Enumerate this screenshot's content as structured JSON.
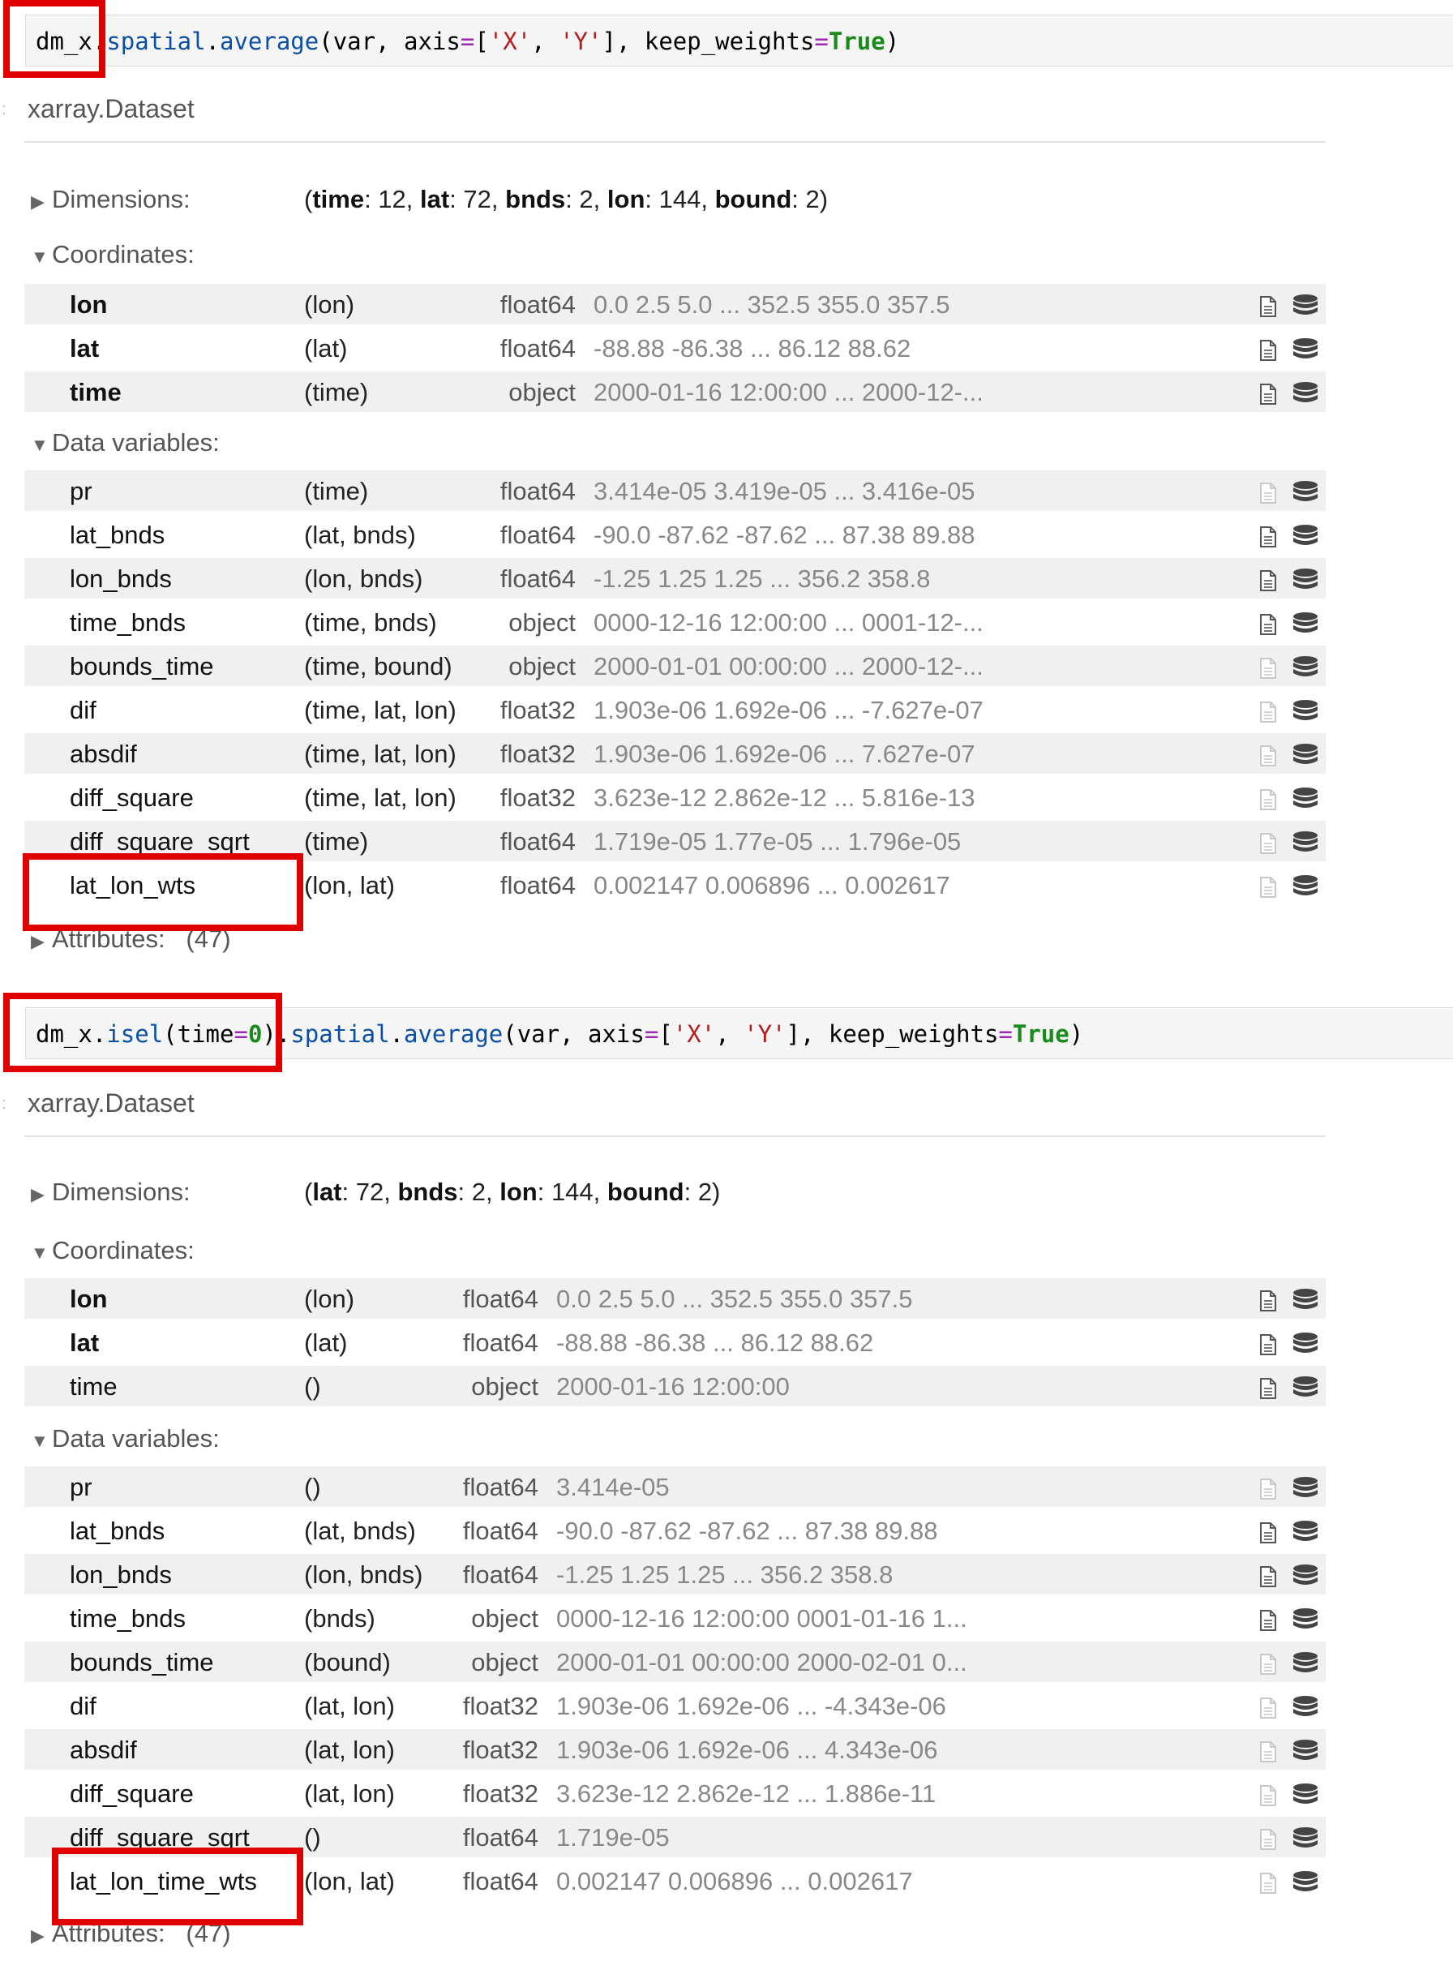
{
  "cells": [
    {
      "code": {
        "obj": "dm_x",
        "accessor": "spatial",
        "method": "average",
        "arg_var": "var",
        "kw_axis": "axis",
        "axis_vals": [
          "'X'",
          "'Y'"
        ],
        "kw_weights": "keep_weights",
        "bool_val": "True"
      },
      "output": {
        "gutter": ":",
        "title": "xarray.Dataset",
        "dimensions": {
          "label": "Dimensions:",
          "items": [
            {
              "name": "time",
              "size": "12"
            },
            {
              "name": "lat",
              "size": "72"
            },
            {
              "name": "bnds",
              "size": "2"
            },
            {
              "name": "lon",
              "size": "144"
            },
            {
              "name": "bound",
              "size": "2"
            }
          ]
        },
        "coordinates": {
          "label": "Coordinates:",
          "rows": [
            {
              "name": "lon",
              "dims": "(lon)",
              "dtype": "float64",
              "preview": "0.0 2.5 5.0 ... 352.5 355.0 357.5"
            },
            {
              "name": "lat",
              "dims": "(lat)",
              "dtype": "float64",
              "preview": "-88.88 -86.38 ... 86.12 88.62"
            },
            {
              "name": "time",
              "dims": "(time)",
              "dtype": "object",
              "preview": "2000-01-16 12:00:00 ... 2000-12-..."
            }
          ]
        },
        "data_variables": {
          "label": "Data variables:",
          "rows": [
            {
              "name": "pr",
              "dims": "(time)",
              "dtype": "float64",
              "preview": "3.414e-05 3.419e-05 ... 3.416e-05"
            },
            {
              "name": "lat_bnds",
              "dims": "(lat, bnds)",
              "dtype": "float64",
              "preview": "-90.0 -87.62 -87.62 ... 87.38 89.88"
            },
            {
              "name": "lon_bnds",
              "dims": "(lon, bnds)",
              "dtype": "float64",
              "preview": "-1.25 1.25 1.25 ... 356.2 358.8"
            },
            {
              "name": "time_bnds",
              "dims": "(time, bnds)",
              "dtype": "object",
              "preview": "0000-12-16 12:00:00 ... 0001-12-..."
            },
            {
              "name": "bounds_time",
              "dims": "(time, bound)",
              "dtype": "object",
              "preview": "2000-01-01 00:00:00 ... 2000-12-..."
            },
            {
              "name": "dif",
              "dims": "(time, lat, lon)",
              "dtype": "float32",
              "preview": "1.903e-06 1.692e-06 ... -7.627e-07"
            },
            {
              "name": "absdif",
              "dims": "(time, lat, lon)",
              "dtype": "float32",
              "preview": "1.903e-06 1.692e-06 ... 7.627e-07"
            },
            {
              "name": "diff_square",
              "dims": "(time, lat, lon)",
              "dtype": "float32",
              "preview": "3.623e-12 2.862e-12 ... 5.816e-13"
            },
            {
              "name": "diff_square_sqrt",
              "dims": "(time)",
              "dtype": "float64",
              "preview": "1.719e-05 1.77e-05 ... 1.796e-05"
            },
            {
              "name": "lat_lon_wts",
              "dims": "(lon, lat)",
              "dtype": "float64",
              "preview": "0.002147 0.006896 ... 0.002617"
            }
          ]
        },
        "attributes": {
          "label": "Attributes:",
          "count": "(47)"
        }
      }
    },
    {
      "code": {
        "obj": "dm_x",
        "isel_method": "isel",
        "isel_kw": "time",
        "isel_val": "0",
        "accessor": "spatial",
        "method": "average",
        "arg_var": "var",
        "kw_axis": "axis",
        "axis_vals": [
          "'X'",
          "'Y'"
        ],
        "kw_weights": "keep_weights",
        "bool_val": "True"
      },
      "output": {
        "gutter": ":",
        "title": "xarray.Dataset",
        "dimensions": {
          "label": "Dimensions:",
          "items": [
            {
              "name": "lat",
              "size": "72"
            },
            {
              "name": "bnds",
              "size": "2"
            },
            {
              "name": "lon",
              "size": "144"
            },
            {
              "name": "bound",
              "size": "2"
            }
          ]
        },
        "coordinates": {
          "label": "Coordinates:",
          "rows": [
            {
              "name": "lon",
              "dims": "(lon)",
              "dtype": "float64",
              "preview": "0.0 2.5 5.0 ... 352.5 355.0 357.5"
            },
            {
              "name": "lat",
              "dims": "(lat)",
              "dtype": "float64",
              "preview": "-88.88 -86.38 ... 86.12 88.62"
            },
            {
              "name": "time",
              "dims": "()",
              "dtype": "object",
              "preview": "2000-01-16 12:00:00"
            }
          ]
        },
        "data_variables": {
          "label": "Data variables:",
          "rows": [
            {
              "name": "pr",
              "dims": "()",
              "dtype": "float64",
              "preview": "3.414e-05"
            },
            {
              "name": "lat_bnds",
              "dims": "(lat, bnds)",
              "dtype": "float64",
              "preview": "-90.0 -87.62 -87.62 ... 87.38 89.88"
            },
            {
              "name": "lon_bnds",
              "dims": "(lon, bnds)",
              "dtype": "float64",
              "preview": "-1.25 1.25 1.25 ... 356.2 358.8"
            },
            {
              "name": "time_bnds",
              "dims": "(bnds)",
              "dtype": "object",
              "preview": "0000-12-16 12:00:00 0001-01-16 1..."
            },
            {
              "name": "bounds_time",
              "dims": "(bound)",
              "dtype": "object",
              "preview": "2000-01-01 00:00:00 2000-02-01 0..."
            },
            {
              "name": "dif",
              "dims": "(lat, lon)",
              "dtype": "float32",
              "preview": "1.903e-06 1.692e-06 ... -4.343e-06"
            },
            {
              "name": "absdif",
              "dims": "(lat, lon)",
              "dtype": "float32",
              "preview": "1.903e-06 1.692e-06 ... 4.343e-06"
            },
            {
              "name": "diff_square",
              "dims": "(lat, lon)",
              "dtype": "float32",
              "preview": "3.623e-12 2.862e-12 ... 1.886e-11"
            },
            {
              "name": "diff_square_sqrt",
              "dims": "()",
              "dtype": "float64",
              "preview": "1.719e-05"
            },
            {
              "name": "lat_lon_time_wts",
              "dims": "(lon, lat)",
              "dtype": "float64",
              "preview": "0.002147 0.006896 ... 0.002617"
            }
          ]
        },
        "attributes": {
          "label": "Attributes:",
          "count": "(47)"
        }
      }
    }
  ],
  "colors": {
    "highlight_box": "#e00000",
    "code_attr": "#0b4ea8",
    "code_string": "#b31d1d",
    "code_operator": "#9c27b0",
    "code_keyword": "#1a8a1a"
  },
  "icons": {
    "show_attrs": "file-doc-icon",
    "show_data": "database-icon"
  }
}
